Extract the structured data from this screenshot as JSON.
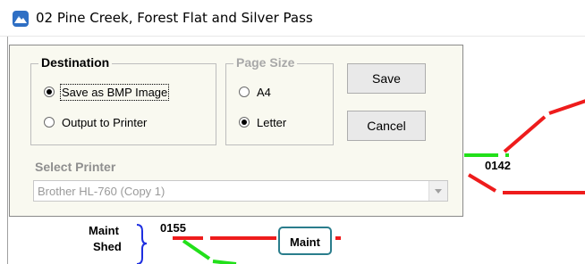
{
  "window": {
    "title": "02 Pine Creek, Forest Flat and Silver Pass"
  },
  "icons": {
    "app_icon": "mountain-app-icon",
    "dropdown_arrow": "chevron-down-icon"
  },
  "dialog": {
    "destination": {
      "title": "Destination",
      "options": [
        {
          "label": "Save as BMP Image",
          "checked": true,
          "focused": true
        },
        {
          "label": "Output to Printer",
          "checked": false
        }
      ]
    },
    "page_size": {
      "title": "Page Size",
      "disabled": true,
      "options": [
        {
          "label": "A4",
          "checked": false
        },
        {
          "label": "Letter",
          "checked": true
        }
      ]
    },
    "buttons": {
      "save": "Save",
      "cancel": "Cancel"
    },
    "printer": {
      "label": "Select Printer",
      "selected": "Brother HL-760 (Copy 1)",
      "disabled": true
    }
  },
  "diagram": {
    "labels": {
      "block_0142": "0142",
      "block_0155": "0155",
      "maint_shed_line1": "Maint",
      "maint_shed_line2": "Shed",
      "maint_box": "Maint"
    },
    "colors": {
      "track_red": "#ee1c1c",
      "track_green": "#22e01a",
      "bracket_blue": "#1e2fe0",
      "box_border": "#2a7d8c"
    }
  }
}
